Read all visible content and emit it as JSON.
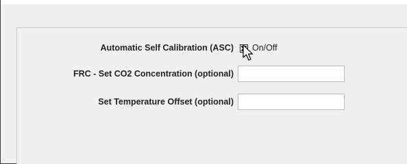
{
  "form": {
    "asc": {
      "label": "Automatic Self Calibration (ASC)",
      "toggle_label": "On/Off",
      "checked": true
    },
    "frc": {
      "label": "FRC - Set CO2 Concentration (optional)",
      "value": ""
    },
    "temp_offset": {
      "label": "Set Temperature Offset (optional)",
      "value": ""
    }
  },
  "icons": {
    "cursor": "arrow-cursor-icon",
    "check": "checkmark-icon"
  },
  "colors": {
    "window_bg": "#f0f0f0",
    "input_bg": "#ffffff",
    "text": "#222222"
  }
}
